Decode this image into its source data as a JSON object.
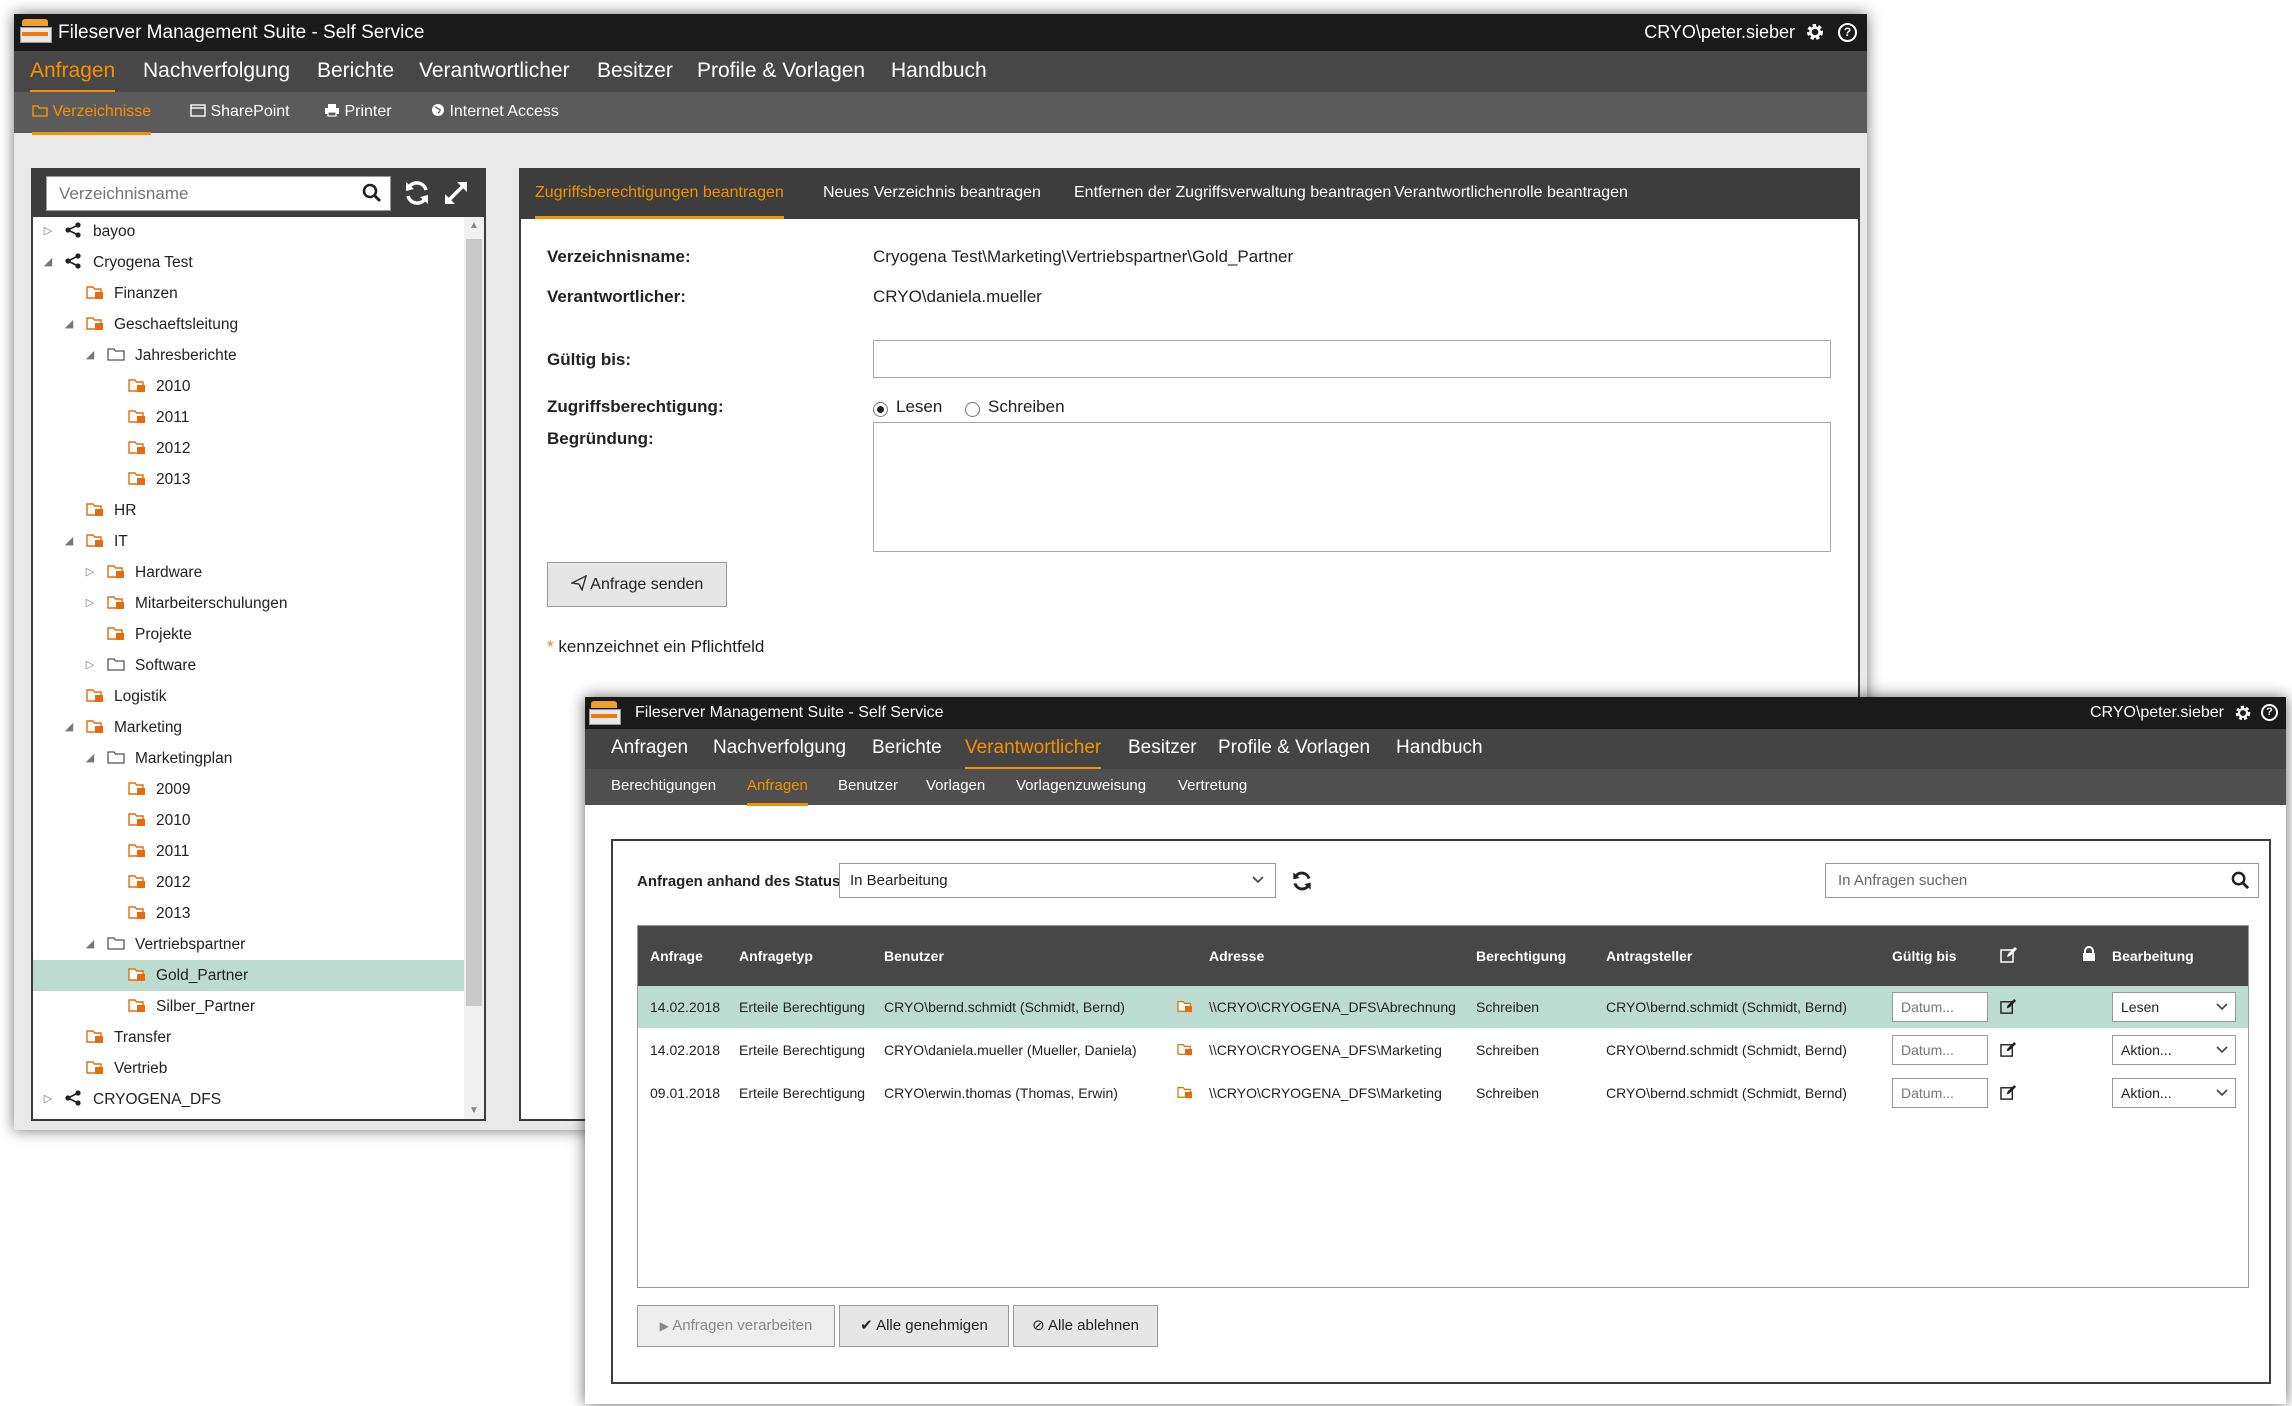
{
  "window1": {
    "title": "Fileserver Management Suite - Self Service",
    "user": "CRYO\\peter.sieber",
    "nav": [
      "Anfragen",
      "Nachverfolgung",
      "Berichte",
      "Verantwortlicher",
      "Besitzer",
      "Profile & Vorlagen",
      "Handbuch"
    ],
    "nav_active": "Anfragen",
    "subnav": [
      "Verzeichnisse",
      "SharePoint",
      "Printer",
      "Internet Access"
    ],
    "subnav_active": "Verzeichnisse",
    "tree": {
      "search_placeholder": "Verzeichnisname",
      "items": [
        {
          "label": "bayoo",
          "level": 0,
          "toggle": "collapsed",
          "icon": "share-icon"
        },
        {
          "label": "Cryogena Test",
          "level": 0,
          "toggle": "expanded",
          "icon": "share-icon"
        },
        {
          "label": "Finanzen",
          "level": 1,
          "toggle": "none",
          "icon": "folder-managed-icon"
        },
        {
          "label": "Geschaeftsleitung",
          "level": 1,
          "toggle": "expanded",
          "icon": "folder-managed-icon"
        },
        {
          "label": "Jahresberichte",
          "level": 2,
          "toggle": "expanded",
          "icon": "folder-icon"
        },
        {
          "label": "2010",
          "level": 3,
          "toggle": "none",
          "icon": "folder-managed-icon"
        },
        {
          "label": "2011",
          "level": 3,
          "toggle": "none",
          "icon": "folder-managed-icon"
        },
        {
          "label": "2012",
          "level": 3,
          "toggle": "none",
          "icon": "folder-managed-icon"
        },
        {
          "label": "2013",
          "level": 3,
          "toggle": "none",
          "icon": "folder-managed-icon"
        },
        {
          "label": "HR",
          "level": 1,
          "toggle": "none",
          "icon": "folder-managed-icon"
        },
        {
          "label": "IT",
          "level": 1,
          "toggle": "expanded",
          "icon": "folder-managed-icon"
        },
        {
          "label": "Hardware",
          "level": 2,
          "toggle": "collapsed",
          "icon": "folder-managed-icon"
        },
        {
          "label": "Mitarbeiterschulungen",
          "level": 2,
          "toggle": "collapsed",
          "icon": "folder-managed-icon"
        },
        {
          "label": "Projekte",
          "level": 2,
          "toggle": "none",
          "icon": "folder-managed-icon"
        },
        {
          "label": "Software",
          "level": 2,
          "toggle": "collapsed",
          "icon": "folder-icon"
        },
        {
          "label": "Logistik",
          "level": 1,
          "toggle": "none",
          "icon": "folder-managed-icon"
        },
        {
          "label": "Marketing",
          "level": 1,
          "toggle": "expanded",
          "icon": "folder-managed-icon"
        },
        {
          "label": "Marketingplan",
          "level": 2,
          "toggle": "expanded",
          "icon": "folder-icon"
        },
        {
          "label": "2009",
          "level": 3,
          "toggle": "none",
          "icon": "folder-managed-icon"
        },
        {
          "label": "2010",
          "level": 3,
          "toggle": "none",
          "icon": "folder-managed-icon"
        },
        {
          "label": "2011",
          "level": 3,
          "toggle": "none",
          "icon": "folder-managed-icon"
        },
        {
          "label": "2012",
          "level": 3,
          "toggle": "none",
          "icon": "folder-managed-icon"
        },
        {
          "label": "2013",
          "level": 3,
          "toggle": "none",
          "icon": "folder-managed-icon"
        },
        {
          "label": "Vertriebspartner",
          "level": 2,
          "toggle": "expanded",
          "icon": "folder-icon"
        },
        {
          "label": "Gold_Partner",
          "level": 3,
          "toggle": "none",
          "icon": "folder-managed-icon",
          "selected": true
        },
        {
          "label": "Silber_Partner",
          "level": 3,
          "toggle": "none",
          "icon": "folder-managed-icon"
        },
        {
          "label": "Transfer",
          "level": 1,
          "toggle": "none",
          "icon": "folder-managed-icon"
        },
        {
          "label": "Vertrieb",
          "level": 1,
          "toggle": "none",
          "icon": "folder-managed-icon"
        },
        {
          "label": "CRYOGENA_DFS",
          "level": 0,
          "toggle": "collapsed",
          "icon": "share-icon"
        }
      ]
    },
    "form": {
      "tabs": [
        "Zugriffsberechtigungen beantragen",
        "Neues Verzeichnis beantragen",
        "Entfernen der Zugriffsverwaltung beantragen",
        "Verantwortlichenrolle beantragen"
      ],
      "tab_active": "Zugriffsberechtigungen beantragen",
      "directory_label": "Verzeichnisname:",
      "directory_value": "Cryogena Test\\Marketing\\Vertriebspartner\\Gold_Partner",
      "owner_label": "Verantwortlicher:",
      "owner_value": "CRYO\\daniela.mueller",
      "valid_label": "Gültig bis:",
      "valid_value": "",
      "access_label": "Zugriffsberechtigung:",
      "access_options": [
        "Lesen",
        "Schreiben"
      ],
      "access_selected": "Lesen",
      "reason_label": "Begründung:",
      "reason_value": "",
      "send_button": "Anfrage senden",
      "required_star": "*",
      "required_note": "kennzeichnet ein Pflichtfeld"
    }
  },
  "window2": {
    "title": "Fileserver Management Suite - Self Service",
    "user": "CRYO\\peter.sieber",
    "nav": [
      "Anfragen",
      "Nachverfolgung",
      "Berichte",
      "Verantwortlicher",
      "Besitzer",
      "Profile & Vorlagen",
      "Handbuch"
    ],
    "nav_active": "Verantwortlicher",
    "subnav": [
      "Berechtigungen",
      "Anfragen",
      "Benutzer",
      "Vorlagen",
      "Vorlagenzuweisung",
      "Vertretung"
    ],
    "subnav_active": "Anfragen",
    "filter_label": "Anfragen anhand des Status filtern:",
    "status_selected": "In Bearbeitung",
    "search_placeholder": "In Anfragen suchen",
    "table": {
      "columns": [
        "Anfrage",
        "Anfragetyp",
        "Benutzer",
        "Adresse",
        "Berechtigung",
        "Antragsteller",
        "Gültig bis",
        "Bearbeitung"
      ],
      "rows": [
        {
          "date": "14.02.2018",
          "type": "Erteile Berechtigung",
          "user": "CRYO\\bernd.schmidt (Schmidt, Bernd)",
          "address": "\\\\CRYO\\CRYOGENA_DFS\\Abrechnung",
          "permission": "Schreiben",
          "requester": "CRYO\\bernd.schmidt (Schmidt, Bernd)",
          "valid_placeholder": "Datum...",
          "action": "Lesen",
          "selected": true
        },
        {
          "date": "14.02.2018",
          "type": "Erteile Berechtigung",
          "user": "CRYO\\daniela.mueller (Mueller, Daniela)",
          "address": "\\\\CRYO\\CRYOGENA_DFS\\Marketing",
          "permission": "Schreiben",
          "requester": "CRYO\\bernd.schmidt (Schmidt, Bernd)",
          "valid_placeholder": "Datum...",
          "action": "Aktion..."
        },
        {
          "date": "09.01.2018",
          "type": "Erteile Berechtigung",
          "user": "CRYO\\erwin.thomas (Thomas, Erwin)",
          "address": "\\\\CRYO\\CRYOGENA_DFS\\Marketing",
          "permission": "Schreiben",
          "requester": "CRYO\\bernd.schmidt (Schmidt, Bernd)",
          "valid_placeholder": "Datum...",
          "action": "Aktion..."
        }
      ]
    },
    "buttons": {
      "process": "Anfragen verarbeiten",
      "approve_all": "Alle genehmigen",
      "reject_all": "Alle ablehnen"
    }
  },
  "colors": {
    "accent": "#f39200",
    "titlebar": "#1a1a1a",
    "nav_bg": "#474747",
    "subnav_bg": "#5b5b5b",
    "panel_header": "#3d3d3d",
    "selected_row": "#bcdcd1"
  }
}
